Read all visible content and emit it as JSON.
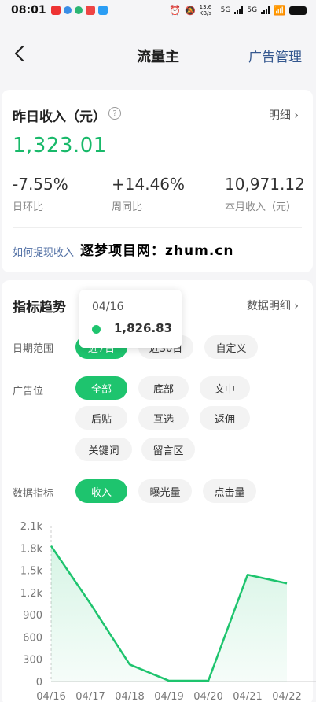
{
  "status": {
    "time": "08:01",
    "net_speed": "13.6 KB/s",
    "sig1": "5G",
    "sig2": "5G"
  },
  "nav": {
    "title": "流量主",
    "right_action": "广告管理"
  },
  "income": {
    "title": "昨日收入（元）",
    "detail_link": "明细",
    "amount": "1,323.01",
    "stats": [
      {
        "value": "-7.55%",
        "label": "日环比"
      },
      {
        "value": "+14.46%",
        "label": "周同比"
      },
      {
        "value": "10,971.12",
        "label": "本月收入（元）"
      }
    ],
    "withdraw_link": "如何提现收入",
    "watermark": "逐梦项目网：zhum.cn"
  },
  "trend": {
    "title": "指标趋势",
    "detail_link": "数据明细",
    "date_range": {
      "label": "日期范围",
      "options": [
        "近7日",
        "近30日",
        "自定义"
      ],
      "selected": "近7日"
    },
    "ad_slot": {
      "label": "广告位",
      "options": [
        "全部",
        "底部",
        "文中",
        "后贴",
        "互选",
        "返佣",
        "关键词",
        "留言区"
      ],
      "selected": "全部"
    },
    "metric": {
      "label": "数据指标",
      "options": [
        "收入",
        "曝光量",
        "点击量"
      ],
      "selected": "收入"
    },
    "tooltip": {
      "date": "04/16",
      "value": "1,826.83"
    }
  },
  "colors": {
    "accent": "#1ec46e",
    "income_green": "#19b96a",
    "link_blue": "#35588f"
  },
  "chart_data": {
    "type": "area",
    "x": [
      "04/16",
      "04/17",
      "04/18",
      "04/19",
      "04/20",
      "04/21",
      "04/22"
    ],
    "y_ticks": [
      "0",
      "300",
      "600",
      "900",
      "1.2k",
      "1.5k",
      "1.8k",
      "2.1k"
    ],
    "ylim": [
      0,
      2100
    ],
    "series": [
      {
        "values": [
          1826.83,
          1050,
          230,
          10,
          10,
          1440,
          1323.01
        ]
      }
    ]
  }
}
